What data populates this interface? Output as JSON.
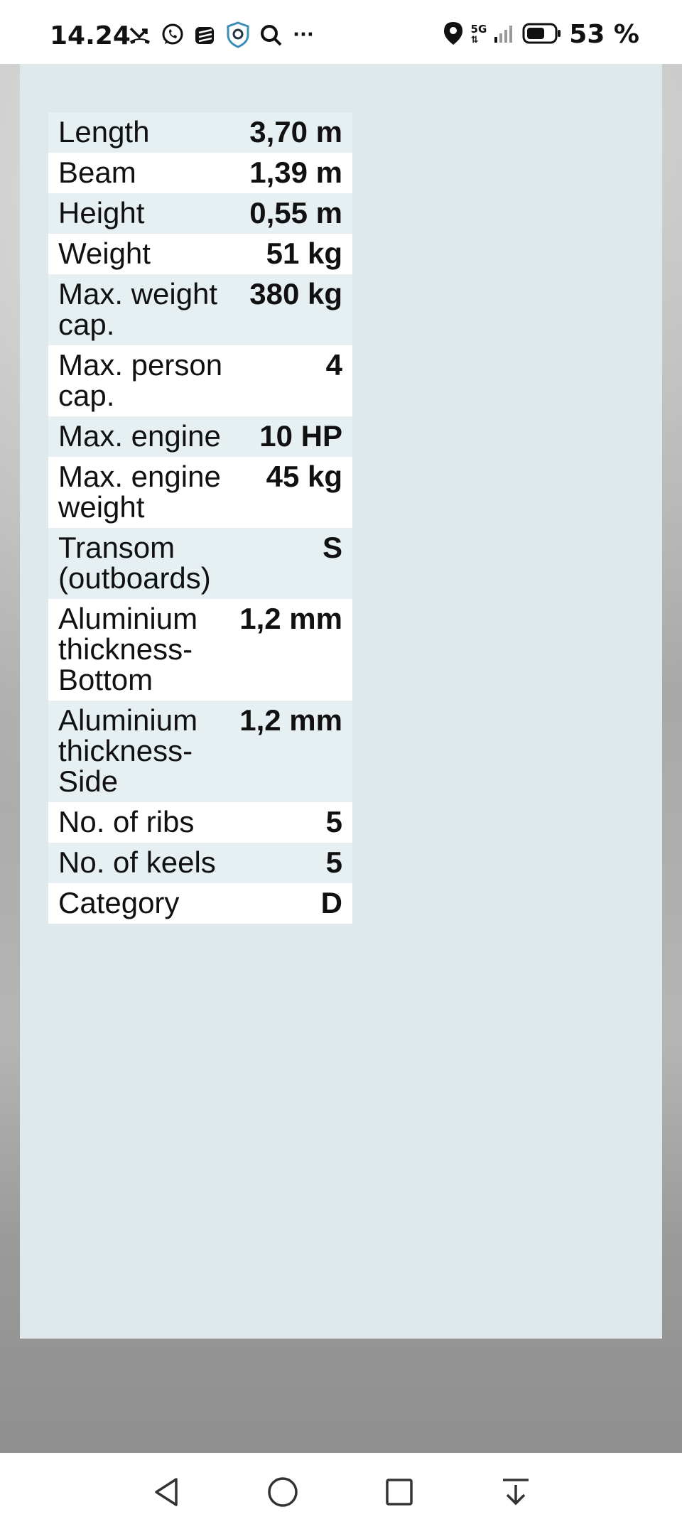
{
  "status_bar": {
    "time": "14.24",
    "more": "···",
    "network": "5G",
    "battery_pct": "53 %"
  },
  "specs": [
    {
      "label": "Length",
      "value": "3,70 m"
    },
    {
      "label": "Beam",
      "value": "1,39 m"
    },
    {
      "label": "Height",
      "value": "0,55 m"
    },
    {
      "label": "Weight",
      "value": "51 kg"
    },
    {
      "label": "Max. weight cap.",
      "value": "380 kg"
    },
    {
      "label": "Max. person cap.",
      "value": "4"
    },
    {
      "label": "Max. engine",
      "value": "10 HP"
    },
    {
      "label": "Max. engine weight",
      "value": "45 kg"
    },
    {
      "label": "Transom (outboards)",
      "value": "S"
    },
    {
      "label": "Aluminium thickness-Bottom",
      "value": "1,2 mm"
    },
    {
      "label": "Aluminium thickness-Side",
      "value": "1,2 mm"
    },
    {
      "label": "No. of ribs",
      "value": "5"
    },
    {
      "label": "No. of keels",
      "value": "5"
    },
    {
      "label": "Category",
      "value": "D"
    }
  ],
  "colors": {
    "card_bg": "#dfe9ec",
    "row_alt": "#e6f0f3",
    "row_white": "#ffffff"
  }
}
